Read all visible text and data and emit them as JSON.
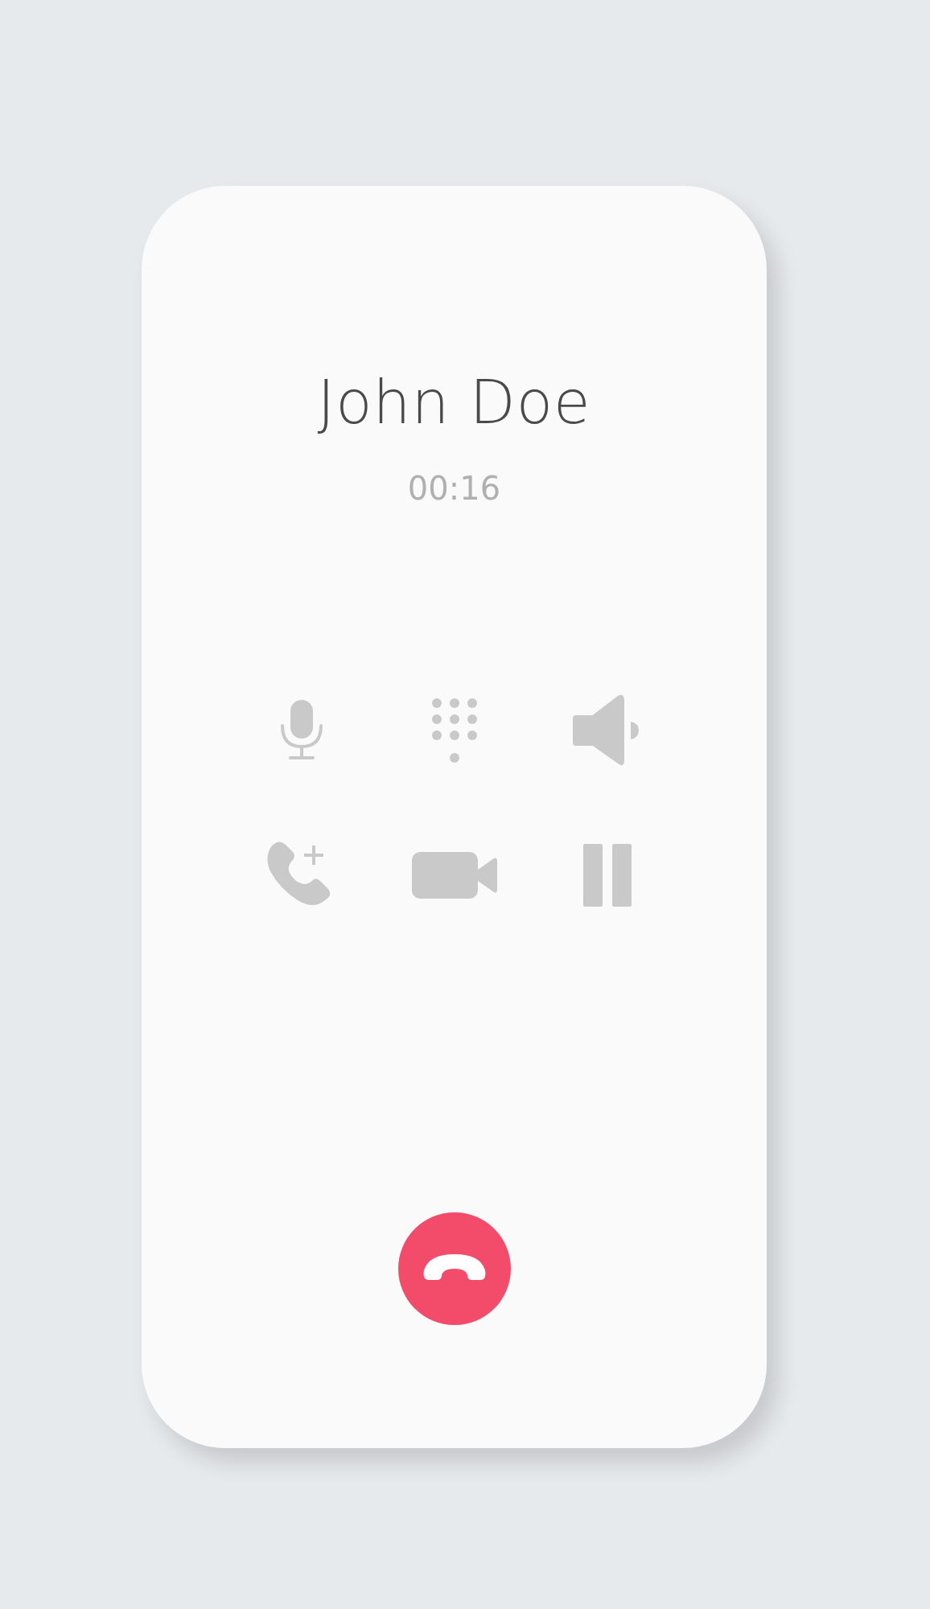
{
  "caller": {
    "name": "John Doe",
    "duration": "00:16"
  },
  "actions": [
    {
      "kind": "mute"
    },
    {
      "kind": "keypad"
    },
    {
      "kind": "speaker"
    },
    {
      "kind": "add_call"
    },
    {
      "kind": "video"
    },
    {
      "kind": "hold"
    }
  ],
  "end_call": {
    "kind": "hang_up"
  }
}
